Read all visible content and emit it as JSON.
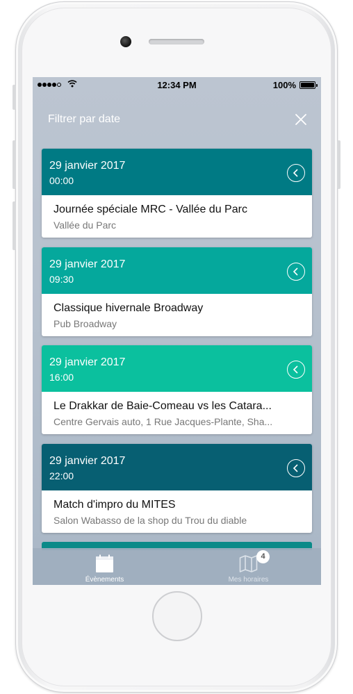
{
  "status_bar": {
    "time": "12:34 PM",
    "battery": "100%"
  },
  "header": {
    "title": "Filtrer par date"
  },
  "events": [
    {
      "date": "29 janvier 2017",
      "time": "00:00",
      "title": "Journée spéciale MRC - Vallée du Parc",
      "venue": "Vallée du Parc",
      "color": "#007a84"
    },
    {
      "date": "29 janvier 2017",
      "time": "09:30",
      "title": "Classique hivernale Broadway",
      "venue": "Pub Broadway",
      "color": "#05a89c"
    },
    {
      "date": "29 janvier 2017",
      "time": "16:00",
      "title": "Le Drakkar de Baie-Comeau vs les Catara...",
      "venue": "Centre Gervais auto, 1 Rue Jacques-Plante, Sha...",
      "color": "#0bc09e"
    },
    {
      "date": "29 janvier 2017",
      "time": "22:00",
      "title": "Match d'impro du MITES",
      "venue": "Salon Wabasso de la shop du Trou du diable",
      "color": "#075f72"
    }
  ],
  "peek_color": "#0a8a88",
  "tabbar": {
    "events_label": "Évènements",
    "schedule_label": "Mes horaires",
    "schedule_badge": "4"
  }
}
